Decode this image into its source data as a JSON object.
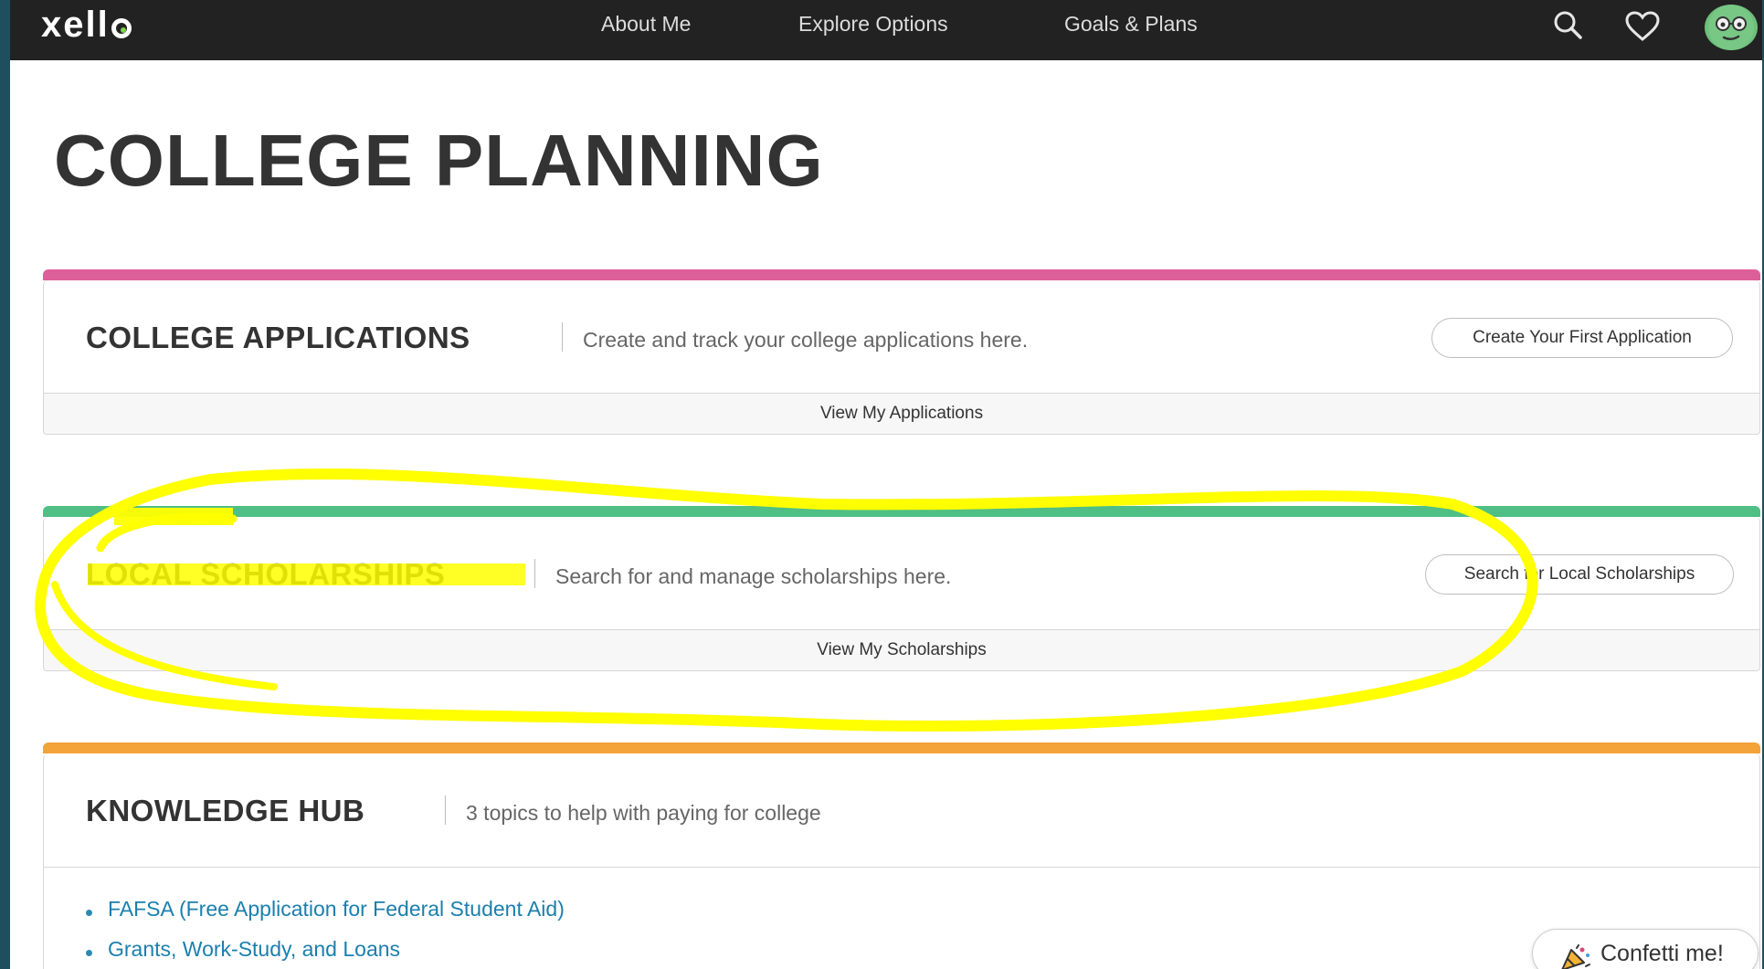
{
  "nav": {
    "logo": "xello",
    "links": [
      "About Me",
      "Explore Options",
      "Goals & Plans"
    ],
    "icons": [
      "search-icon",
      "heart-icon",
      "avatar"
    ]
  },
  "page": {
    "title": "COLLEGE PLANNING"
  },
  "cards": {
    "applications": {
      "title": "COLLEGE APPLICATIONS",
      "description": "Create and track your college applications here.",
      "button": "Create Your First Application",
      "footer": "View My Applications",
      "accent": "#dd5f9a"
    },
    "scholarships": {
      "title": "LOCAL SCHOLARSHIPS",
      "description": "Search for and manage scholarships here.",
      "button": "Search for Local Scholarships",
      "footer": "View My Scholarships",
      "accent": "#4fbf85"
    },
    "knowledge": {
      "title": "KNOWLEDGE HUB",
      "description": "3 topics to help with paying for college",
      "accent": "#f4a23a",
      "topics": [
        "FAFSA (Free Application for Federal Student Aid)",
        "Grants, Work-Study, and Loans"
      ]
    }
  },
  "confetti": {
    "label": "Confetti me!"
  },
  "annotation": {
    "color": "#ffff00"
  }
}
